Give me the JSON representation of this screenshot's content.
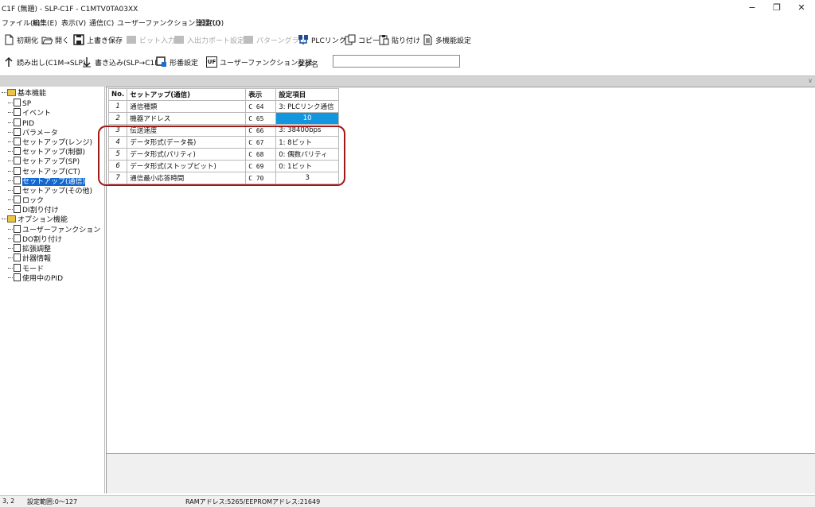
{
  "window": {
    "title": "C1F (無題) - SLP-C1F - C1MTV0TA03XX",
    "minimize_label": "−",
    "maximize_label": "❐",
    "close_label": "✕"
  },
  "menu": [
    "ファイル(F)",
    "編集(E)",
    "表示(V)",
    "通信(C)",
    "ユーザーファンクション登録(U)",
    "設定(O)"
  ],
  "toolbar1": {
    "new": "初期化",
    "open": "開く",
    "save": "上書き保存",
    "bit_input": "ビット入力",
    "io_port": "入出力ポート設定",
    "pattern_graph": "パターングラフ",
    "plc_link": "PLCリンク",
    "copy": "コピー",
    "paste": "貼り付け",
    "multi_setting": "多機能設定"
  },
  "toolbar2": {
    "read": "読み出し(C1M→SLP)",
    "write": "書き込み(SLP→C1M)",
    "model_setting": "形番設定",
    "uf_icon": "UF",
    "uf_register": "ユーザーファンクション登録",
    "tag_label": "タグ名",
    "tag_value": ""
  },
  "tree": {
    "basic_group": "基本機能",
    "basic_items": [
      "SP",
      "イベント",
      "PID",
      "パラメータ",
      "セットアップ(レンジ)",
      "セットアップ(制御)",
      "セットアップ(SP)",
      "セットアップ(CT)",
      "セットアップ(通信)",
      "セットアップ(その他)",
      "ロック",
      "DI割り付け"
    ],
    "selected_index": 8,
    "option_group": "オプション機能",
    "option_items": [
      "ユーザーファンクション",
      "DO割り付け",
      "拡張調整",
      "計器情報",
      "モード",
      "使用中のPID"
    ]
  },
  "table": {
    "headers": [
      "No.",
      "セットアップ(通信)",
      "表示",
      "設定項目"
    ],
    "rows": [
      {
        "no": "1",
        "name": "通信種類",
        "display": "C 64",
        "value": "3: PLCリンク通信"
      },
      {
        "no": "2",
        "name": "機器アドレス",
        "display": "C 65",
        "value": "10"
      },
      {
        "no": "3",
        "name": "伝送速度",
        "display": "C 66",
        "value": "3: 38400bps"
      },
      {
        "no": "4",
        "name": "データ形式(データ長)",
        "display": "C 67",
        "value": "1: 8ビット"
      },
      {
        "no": "5",
        "name": "データ形式(パリティ)",
        "display": "C 68",
        "value": "0: 偶数パリティ"
      },
      {
        "no": "6",
        "name": "データ形式(ストップビット)",
        "display": "C 69",
        "value": "0: 1ビット"
      },
      {
        "no": "7",
        "name": "通信最小応答時間",
        "display": "C 70",
        "value": "3"
      }
    ],
    "selected_row": 1
  },
  "status": {
    "position": "3, 2",
    "range": "設定範囲:0～127",
    "address": "RAMアドレス:5265/EEPROMアドレス:21649"
  },
  "colors": {
    "selection": "#1296e0",
    "tree_selection": "#1168d0",
    "highlight": "#a01818"
  }
}
